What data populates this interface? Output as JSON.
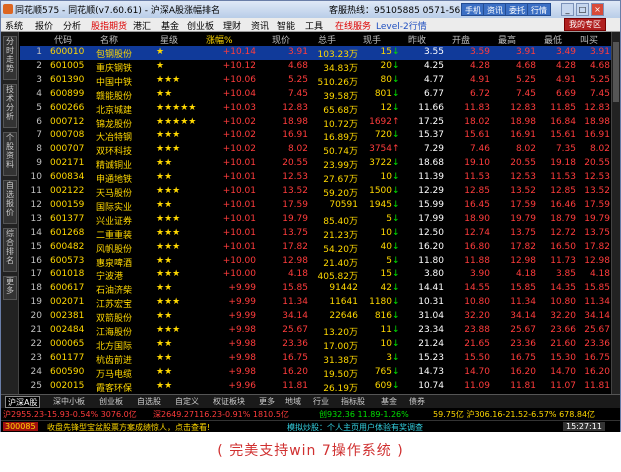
{
  "window": {
    "title": "同花顺575 - 同花顺(v7.60.61) - 沪深A股涨幅排名",
    "hotline": "客服热线：95105885  0571-56768888"
  },
  "titlebar_buttons": [
    "手机",
    "资讯",
    "委托",
    "行情"
  ],
  "menu": {
    "items": [
      "系统",
      "报价",
      "分析",
      "股指期货",
      "港汇",
      "基金",
      "创业板",
      "理财",
      "资讯",
      "智能",
      "工具"
    ],
    "online": "在线服务",
    "level2": "Level-2行情",
    "home": "我的专区"
  },
  "sidebar": [
    "分时走势",
    "技术分析",
    "个股资料",
    "自选报价",
    "综合排名",
    "更多"
  ],
  "columns": [
    "代码",
    "名称",
    "星级",
    "涨幅%",
    "现价",
    "总手",
    "现手",
    "昨收",
    "开盘",
    "最高",
    "最低",
    "叫买"
  ],
  "rows": [
    {
      "n": "1",
      "code": "600010",
      "name": "包钢股份",
      "stars": "★",
      "chg": "+10.14",
      "price": "3.91",
      "vol": "103.23万",
      "cur": "15",
      "dir": "↓",
      "prev": "3.55",
      "open": "3.59",
      "high": "3.91",
      "low": "3.49",
      "bid": "3.91"
    },
    {
      "n": "2",
      "code": "601005",
      "name": "重庆钢铁",
      "stars": "★",
      "chg": "+10.12",
      "price": "4.68",
      "vol": "34.83万",
      "cur": "20",
      "dir": "↓",
      "prev": "4.25",
      "open": "4.28",
      "high": "4.68",
      "low": "4.28",
      "bid": "4.68"
    },
    {
      "n": "3",
      "code": "601390",
      "name": "中国中铁",
      "stars": "★★★",
      "chg": "+10.06",
      "price": "5.25",
      "vol": "510.26万",
      "cur": "80",
      "dir": "↓",
      "prev": "4.77",
      "open": "4.91",
      "high": "5.25",
      "low": "4.91",
      "bid": "5.25"
    },
    {
      "n": "4",
      "code": "600899",
      "name": "赣能股份",
      "stars": "★★",
      "chg": "+10.04",
      "price": "7.45",
      "vol": "39.58万",
      "cur": "801",
      "dir": "↓",
      "prev": "6.77",
      "open": "6.72",
      "high": "7.45",
      "low": "6.69",
      "bid": "7.45"
    },
    {
      "n": "5",
      "code": "600266",
      "name": "北京城建",
      "stars": "★★★★★",
      "chg": "+10.03",
      "price": "12.83",
      "vol": "65.68万",
      "cur": "12",
      "dir": "↓",
      "prev": "11.66",
      "open": "11.83",
      "high": "12.83",
      "low": "11.85",
      "bid": "12.83"
    },
    {
      "n": "6",
      "code": "000712",
      "name": "锦龙股份",
      "stars": "★★★★★",
      "chg": "+10.02",
      "price": "18.98",
      "vol": "10.72万",
      "cur": "1692",
      "dir": "↑",
      "prev": "17.25",
      "open": "18.02",
      "high": "18.98",
      "low": "16.84",
      "bid": "18.98"
    },
    {
      "n": "7",
      "code": "000708",
      "name": "大冶特钢",
      "stars": "★★★",
      "chg": "+10.02",
      "price": "16.91",
      "vol": "16.89万",
      "cur": "720",
      "dir": "↓",
      "prev": "15.37",
      "open": "15.61",
      "high": "16.91",
      "low": "15.61",
      "bid": "16.91"
    },
    {
      "n": "8",
      "code": "000707",
      "name": "双环科技",
      "stars": "★★★",
      "chg": "+10.02",
      "price": "8.02",
      "vol": "50.74万",
      "cur": "3754",
      "dir": "↑",
      "prev": "7.29",
      "open": "7.46",
      "high": "8.02",
      "low": "7.35",
      "bid": "8.02"
    },
    {
      "n": "9",
      "code": "002171",
      "name": "精诚铜业",
      "stars": "★★",
      "chg": "+10.01",
      "price": "20.55",
      "vol": "23.99万",
      "cur": "3722",
      "dir": "↓",
      "prev": "18.68",
      "open": "19.10",
      "high": "20.55",
      "low": "19.18",
      "bid": "20.55"
    },
    {
      "n": "10",
      "code": "600834",
      "name": "申通地铁",
      "stars": "★★",
      "chg": "+10.01",
      "price": "12.53",
      "vol": "27.67万",
      "cur": "10",
      "dir": "↓",
      "prev": "11.39",
      "open": "11.53",
      "high": "12.53",
      "low": "11.53",
      "bid": "12.53"
    },
    {
      "n": "11",
      "code": "002122",
      "name": "天马股份",
      "stars": "★★★",
      "chg": "+10.01",
      "price": "13.52",
      "vol": "59.20万",
      "cur": "1500",
      "dir": "↓",
      "prev": "12.29",
      "open": "12.85",
      "high": "13.52",
      "low": "12.85",
      "bid": "13.52"
    },
    {
      "n": "12",
      "code": "000159",
      "name": "国际实业",
      "stars": "★★",
      "chg": "+10.01",
      "price": "17.59",
      "vol": "70591",
      "cur": "1945",
      "dir": "↓",
      "prev": "15.99",
      "open": "16.45",
      "high": "17.59",
      "low": "16.46",
      "bid": "17.59"
    },
    {
      "n": "13",
      "code": "601377",
      "name": "兴业证券",
      "stars": "★★★",
      "chg": "+10.01",
      "price": "19.79",
      "vol": "85.40万",
      "cur": "5",
      "dir": "↓",
      "prev": "17.99",
      "open": "18.90",
      "high": "19.79",
      "low": "18.79",
      "bid": "19.79"
    },
    {
      "n": "14",
      "code": "601268",
      "name": "二重重装",
      "stars": "★★★",
      "chg": "+10.01",
      "price": "13.75",
      "vol": "21.23万",
      "cur": "10",
      "dir": "↓",
      "prev": "12.50",
      "open": "12.74",
      "high": "13.75",
      "low": "12.72",
      "bid": "13.75"
    },
    {
      "n": "15",
      "code": "600482",
      "name": "风帆股份",
      "stars": "★★★",
      "chg": "+10.01",
      "price": "17.82",
      "vol": "54.20万",
      "cur": "40",
      "dir": "↓",
      "prev": "16.20",
      "open": "16.80",
      "high": "17.82",
      "low": "16.50",
      "bid": "17.82"
    },
    {
      "n": "16",
      "code": "600573",
      "name": "惠泉啤酒",
      "stars": "★★",
      "chg": "+10.00",
      "price": "12.98",
      "vol": "21.40万",
      "cur": "5",
      "dir": "↓",
      "prev": "11.80",
      "open": "11.88",
      "high": "12.98",
      "low": "11.73",
      "bid": "12.98"
    },
    {
      "n": "17",
      "code": "601018",
      "name": "宁波港",
      "stars": "★★★",
      "chg": "+10.00",
      "price": "4.18",
      "vol": "405.82万",
      "cur": "15",
      "dir": "↓",
      "prev": "3.80",
      "open": "3.90",
      "high": "4.18",
      "low": "3.85",
      "bid": "4.18"
    },
    {
      "n": "18",
      "code": "600617",
      "name": "石油济柴",
      "stars": "★★",
      "chg": "+9.99",
      "price": "15.85",
      "vol": "91442",
      "cur": "42",
      "dir": "↓",
      "prev": "14.41",
      "open": "14.55",
      "high": "15.85",
      "low": "14.35",
      "bid": "15.85"
    },
    {
      "n": "19",
      "code": "002071",
      "name": "江苏宏宝",
      "stars": "★★★",
      "chg": "+9.99",
      "price": "11.34",
      "vol": "11641",
      "cur": "1180",
      "dir": "↓",
      "prev": "10.31",
      "open": "10.80",
      "high": "11.34",
      "low": "10.80",
      "bid": "11.34"
    },
    {
      "n": "20",
      "code": "002381",
      "name": "双箭股份",
      "stars": "★★",
      "chg": "+9.99",
      "price": "34.14",
      "vol": "22646",
      "cur": "816",
      "dir": "↓",
      "prev": "31.04",
      "open": "32.20",
      "high": "34.14",
      "low": "32.20",
      "bid": "34.14"
    },
    {
      "n": "21",
      "code": "002484",
      "name": "江海股份",
      "stars": "★★★",
      "chg": "+9.98",
      "price": "25.67",
      "vol": "13.20万",
      "cur": "11",
      "dir": "↓",
      "prev": "23.34",
      "open": "23.88",
      "high": "25.67",
      "low": "23.66",
      "bid": "25.67"
    },
    {
      "n": "22",
      "code": "000065",
      "name": "北方国际",
      "stars": "★★",
      "chg": "+9.98",
      "price": "23.36",
      "vol": "17.00万",
      "cur": "10",
      "dir": "↓",
      "prev": "21.24",
      "open": "21.65",
      "high": "23.36",
      "low": "21.60",
      "bid": "23.36"
    },
    {
      "n": "23",
      "code": "601177",
      "name": "杭齿前进",
      "stars": "★★",
      "chg": "+9.98",
      "price": "16.75",
      "vol": "31.38万",
      "cur": "3",
      "dir": "↓",
      "prev": "15.23",
      "open": "15.50",
      "high": "16.75",
      "low": "15.30",
      "bid": "16.75"
    },
    {
      "n": "24",
      "code": "600590",
      "name": "万马电缆",
      "stars": "★★",
      "chg": "+9.98",
      "price": "16.20",
      "vol": "19.50万",
      "cur": "765",
      "dir": "↓",
      "prev": "14.73",
      "open": "14.70",
      "high": "16.20",
      "low": "14.70",
      "bid": "16.20"
    },
    {
      "n": "25",
      "code": "002015",
      "name": "霞客环保",
      "stars": "★★",
      "chg": "+9.96",
      "price": "11.81",
      "vol": "26.19万",
      "cur": "609",
      "dir": "↓",
      "prev": "10.74",
      "open": "11.09",
      "high": "11.81",
      "low": "11.07",
      "bid": "11.81"
    }
  ],
  "tabs": [
    "沪深A股",
    "深中小板",
    "创业板",
    "自选股",
    "自定义",
    "权证板块",
    "更多",
    "地域",
    "行业",
    "指标股",
    "基金",
    "债券"
  ],
  "ticker": {
    "sh": "沪2955.23-15.93-0.54% 3076.0亿",
    "sz": "深2649.27116.23-0.91% 1810.5亿",
    "cyb": "创932.36 11.89-1.26%",
    "right": "59.75亿 沪306.16-21.52-6.57% 678.84亿"
  },
  "status": {
    "code": "300085",
    "msg1": "收盘先锋型宝盆股票方案成绩惊人，点击查看!",
    "msg2": "模拟炒股：个人主页用户体验有奖调查",
    "time": "15:27:11"
  },
  "caption": "(   完美支持win 7操作系统   )"
}
